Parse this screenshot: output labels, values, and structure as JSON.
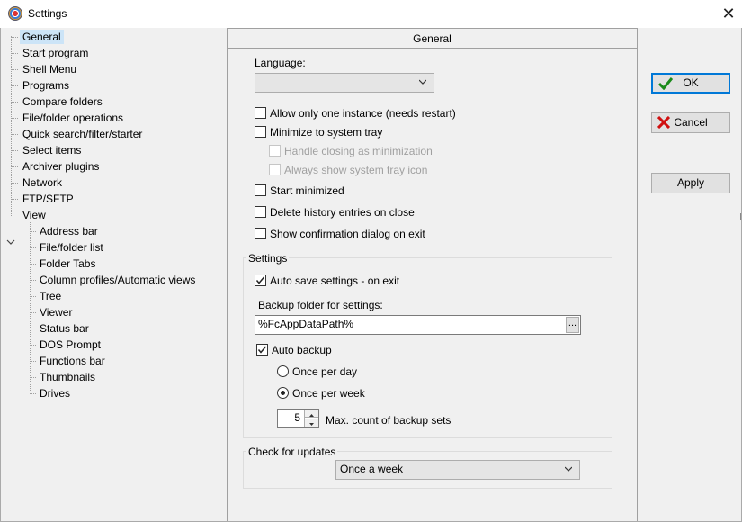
{
  "window": {
    "title": "Settings"
  },
  "tree": {
    "items": [
      {
        "label": "General",
        "selected": true
      },
      {
        "label": "Start program"
      },
      {
        "label": "Shell Menu"
      },
      {
        "label": "Programs"
      },
      {
        "label": "Compare folders"
      },
      {
        "label": "File/folder operations"
      },
      {
        "label": "Quick search/filter/starter"
      },
      {
        "label": "Select items"
      },
      {
        "label": "Archiver plugins"
      },
      {
        "label": "Network"
      },
      {
        "label": "FTP/SFTP"
      },
      {
        "label": "View",
        "expanded": true
      }
    ],
    "view_children": [
      "Address bar",
      "File/folder list",
      "Folder Tabs",
      "Column profiles/Automatic views",
      "Tree",
      "Viewer",
      "Status bar",
      "DOS Prompt",
      "Functions bar",
      "Thumbnails",
      "Drives"
    ]
  },
  "panel": {
    "header": "General",
    "language_label": "Language:",
    "language_value": "",
    "options": {
      "single_instance": {
        "label": "Allow only one instance (needs restart)",
        "checked": false
      },
      "minimize_tray": {
        "label": "Minimize to system tray",
        "checked": false
      },
      "handle_closing": {
        "label": "Handle closing as minimization",
        "checked": false,
        "disabled": true
      },
      "always_tray_icon": {
        "label": "Always show system tray icon",
        "checked": false,
        "disabled": true
      },
      "start_minimized": {
        "label": "Start minimized",
        "checked": false
      },
      "delete_history": {
        "label": "Delete history entries on close",
        "checked": false
      },
      "confirm_exit": {
        "label": "Show confirmation dialog on exit",
        "checked": false
      }
    },
    "settings_group": {
      "title": "Settings",
      "auto_save": {
        "label": "Auto save settings - on exit",
        "checked": true
      },
      "backup_folder_label": "Backup folder for settings:",
      "backup_folder_value": "%FcAppDataPath%",
      "browse_label": "...",
      "auto_backup": {
        "label": "Auto backup",
        "checked": true
      },
      "once_per_day": {
        "label": "Once per day",
        "selected": false
      },
      "once_per_week": {
        "label": "Once per week",
        "selected": true
      },
      "max_backup_count": "5",
      "max_backup_label": "Max. count of backup sets"
    },
    "updates_group": {
      "title": "Check for updates",
      "value": "Once a week"
    }
  },
  "buttons": {
    "ok": "OK",
    "cancel": "Cancel",
    "apply": "Apply"
  },
  "colors": {
    "selection": "#cce4f7",
    "accent": "#0078d7",
    "ok_green": "#1a8a1a",
    "cancel_red": "#d01010"
  }
}
